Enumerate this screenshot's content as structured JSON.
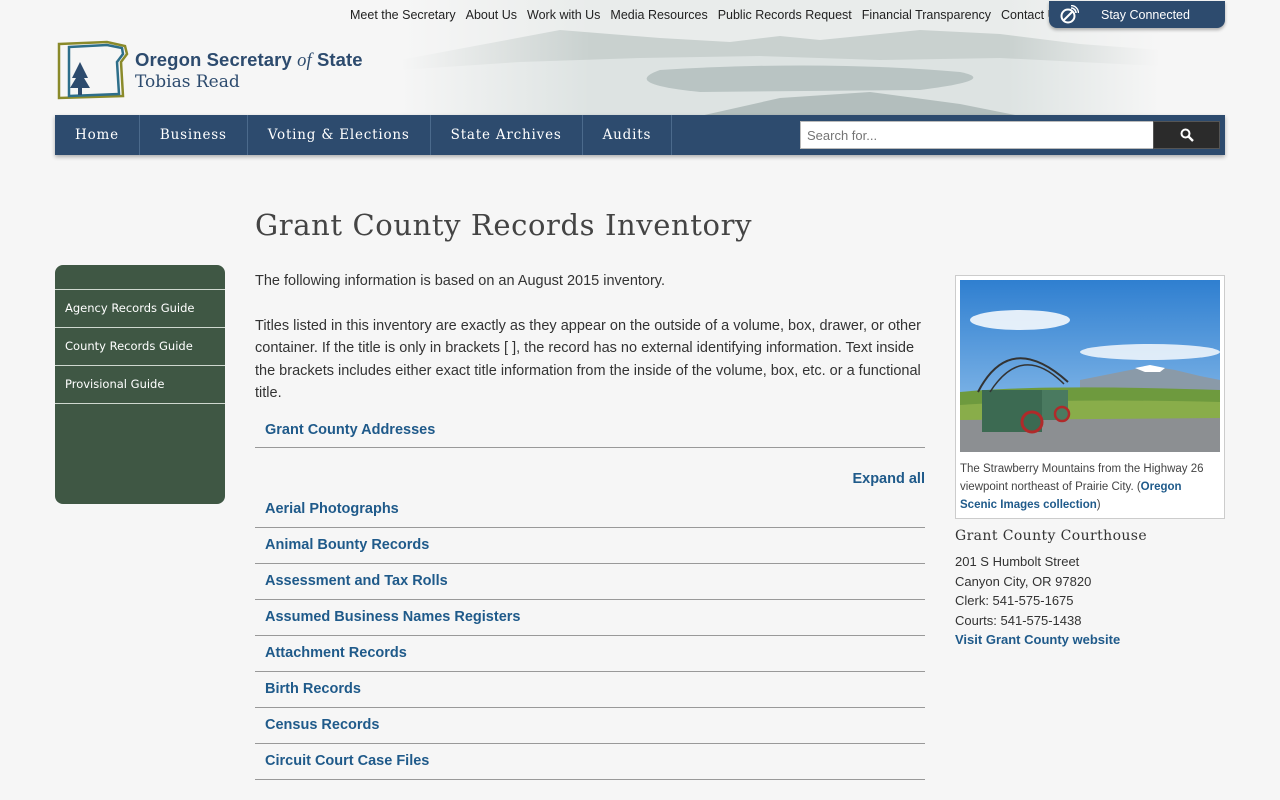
{
  "utility_nav": [
    "Meet the Secretary",
    "About Us",
    "Work with Us",
    "Media Resources",
    "Public Records Request",
    "Financial Transparency",
    "Contact Us"
  ],
  "stay_connected": "Stay Connected",
  "logo": {
    "line1_pre": "Oregon Secretary ",
    "line1_of": "of",
    "line1_post": " State",
    "line2": "Tobias Read"
  },
  "main_nav": [
    "Home",
    "Business",
    "Voting & Elections",
    "State Archives",
    "Audits"
  ],
  "search": {
    "placeholder": "Search for..."
  },
  "page_title": "Grant County Records Inventory",
  "sidebar": [
    "Agency Records Guide",
    "County Records Guide",
    "Provisional Guide"
  ],
  "intro": [
    "The following information is based on an August 2015 inventory.",
    "Titles listed in this inventory are exactly as they appear on the outside of a volume, box, drawer, or other container. If the title is only in brackets [ ], the record has no external identifying information. Text inside the brackets includes either exact title information from the inside of the volume, box, etc. or a functional title."
  ],
  "addresses_link": "Grant County Addresses",
  "expand_all": "Expand all",
  "record_series": [
    "Aerial Photographs",
    "Animal Bounty Records",
    "Assessment and Tax Rolls",
    "Assumed Business Names Registers",
    "Attachment Records",
    "Birth Records",
    "Census Records",
    "Circuit Court Case Files"
  ],
  "photo_caption": {
    "text": "The Strawberry Mountains from the Highway 26 viewpoint northeast of Prairie City. (",
    "link": "Oregon Scenic Images collection",
    "end": ")"
  },
  "courthouse": {
    "title": "Grant County Courthouse",
    "lines": [
      "201 S Humbolt Street",
      "Canyon City, OR 97820",
      "Clerk: 541-575-1675",
      "Courts: 541-575-1438"
    ],
    "link": "Visit Grant County website"
  },
  "colors": {
    "navy": "#2d4b6e",
    "sidebar_green": "#3f5744",
    "link_blue": "#1f5a8a"
  }
}
